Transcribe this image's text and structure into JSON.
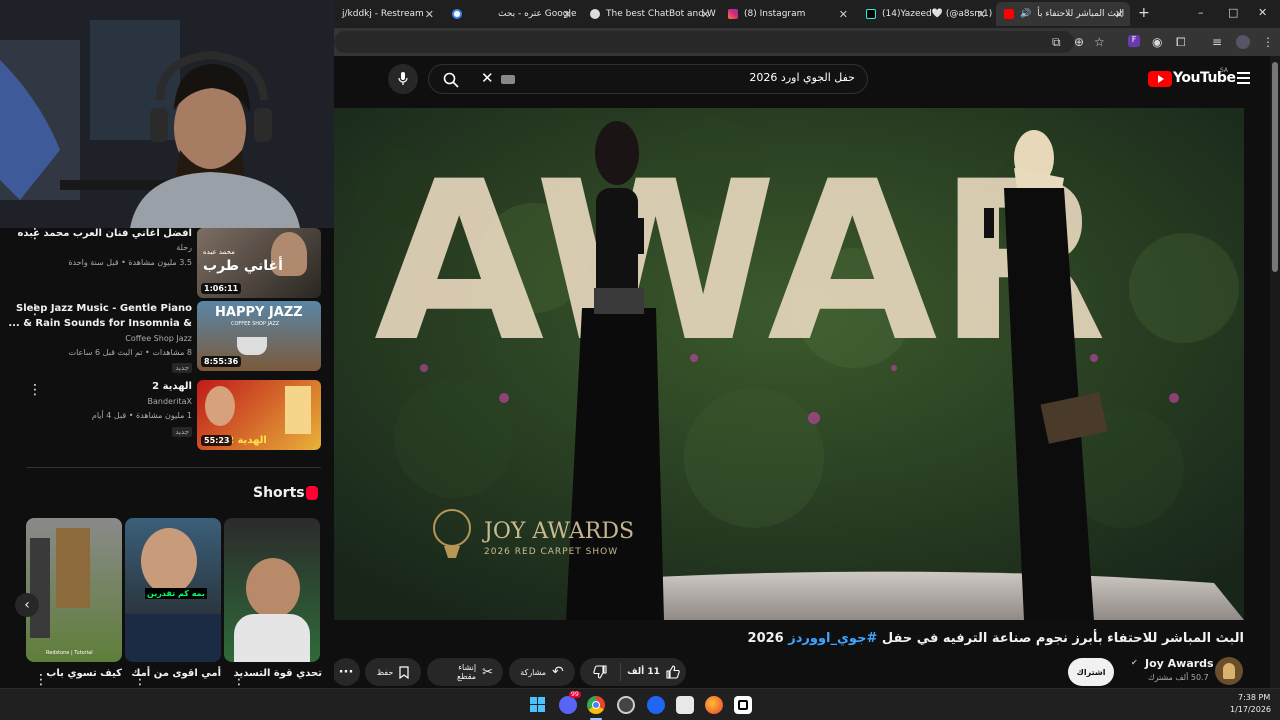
{
  "browser": {
    "tabs": [
      {
        "title": "j/kddkj - Restream",
        "color": "#3a3a3a"
      },
      {
        "title": "عتره - بحث Google",
        "color": "#4285f4"
      },
      {
        "title": "The best ChatBot and Wi",
        "color": "#dddddd"
      },
      {
        "title": "(8) Instagram",
        "color": "#e1306c"
      },
      {
        "title": "(14)Yazeed🤍 (@a8sm1)",
        "color": "#222222"
      },
      {
        "title": "البث المباشر للاحتفاء بأ",
        "color": "#ff0000"
      }
    ],
    "new_tab": "+",
    "minimize": "–",
    "maximize": "□",
    "close": "✕"
  },
  "youtube": {
    "logo_text": "YouTube",
    "region": "SA",
    "search_query": "حفل الجوي اورد 2026"
  },
  "video": {
    "overlay_title": "JOY AWARDS",
    "overlay_subtitle": "2026 RED CARPET SHOW",
    "backdrop_text": "AWAR",
    "title_prefix": "البث المباشر للاحتفاء بأبرز نجوم صناعة الترفيه في حفل",
    "title_hashtag": "#جوي_اووردز",
    "title_suffix": "2026",
    "channel_name": "Joy Awards",
    "subscribers": "50.7 ألف مشترك",
    "subscribe_label": "اشتراك",
    "likes": "11 ألف",
    "share_label": "مشاركة",
    "clip_label": "إنشاء مقطع",
    "save_label": "حفظ"
  },
  "sidebar": {
    "related": [
      {
        "title": "افضل اغاني فنان العرب محمد عبده",
        "channel": "رحلة",
        "meta": "3.5 مليون مشاهدة • قبل سنة واحدة",
        "duration": "1:06:11",
        "thumb_caption": "أغاني طرب",
        "thumb_subcaption": "محمد عبده"
      },
      {
        "title": "Sleep Jazz Music - Gentle Piano",
        "title2": "& Rain Sounds for Insomnia & ...",
        "channel": "Coffee Shop Jazz",
        "meta": "8 مشاهدات • تم البث قبل 6 ساعات",
        "badge": "جديد",
        "duration": "8:55:36",
        "thumb_caption": "HAPPY JAZZ",
        "thumb_subcaption": "COFFEE SHOP JAZZ"
      },
      {
        "title": "الهدية 2",
        "channel": "BanderitaX",
        "meta": "1 مليون مشاهدة • قبل 4 أيام",
        "badge": "جديد",
        "duration": "55:23",
        "thumb_caption": "الهدية 2"
      }
    ],
    "shorts_heading": "Shorts",
    "shorts": [
      {
        "title": "كيف تسوي باب",
        "caption": "Redstone | Tutorial"
      },
      {
        "title": "أمي اقوى من أمك",
        "caption": "بمه كم تقدرين"
      },
      {
        "title": "تحدي قوة التسديد",
        "caption": ""
      }
    ]
  },
  "taskbar": {
    "time": "7:38 PM",
    "date": "1/17/2026",
    "discord_badge": "99"
  }
}
